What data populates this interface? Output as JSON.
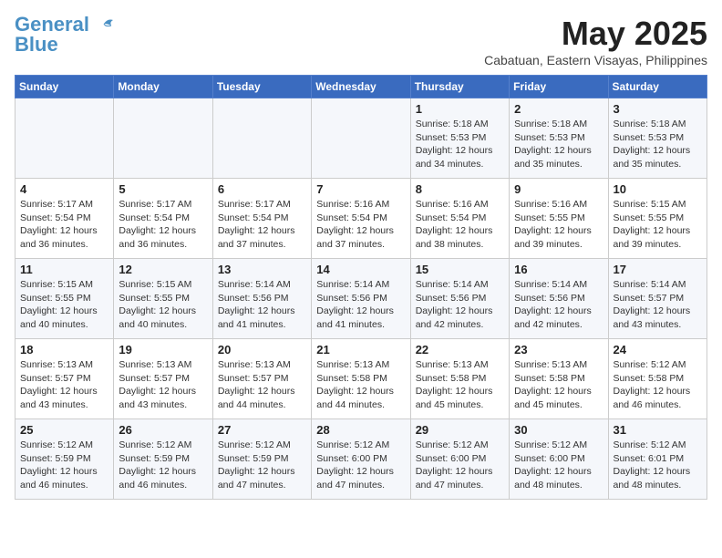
{
  "header": {
    "logo_line1": "General",
    "logo_line2": "Blue",
    "month_title": "May 2025",
    "location": "Cabatuan, Eastern Visayas, Philippines"
  },
  "weekdays": [
    "Sunday",
    "Monday",
    "Tuesday",
    "Wednesday",
    "Thursday",
    "Friday",
    "Saturday"
  ],
  "weeks": [
    [
      {
        "day": "",
        "info": ""
      },
      {
        "day": "",
        "info": ""
      },
      {
        "day": "",
        "info": ""
      },
      {
        "day": "",
        "info": ""
      },
      {
        "day": "1",
        "info": "Sunrise: 5:18 AM\nSunset: 5:53 PM\nDaylight: 12 hours\nand 34 minutes."
      },
      {
        "day": "2",
        "info": "Sunrise: 5:18 AM\nSunset: 5:53 PM\nDaylight: 12 hours\nand 35 minutes."
      },
      {
        "day": "3",
        "info": "Sunrise: 5:18 AM\nSunset: 5:53 PM\nDaylight: 12 hours\nand 35 minutes."
      }
    ],
    [
      {
        "day": "4",
        "info": "Sunrise: 5:17 AM\nSunset: 5:54 PM\nDaylight: 12 hours\nand 36 minutes."
      },
      {
        "day": "5",
        "info": "Sunrise: 5:17 AM\nSunset: 5:54 PM\nDaylight: 12 hours\nand 36 minutes."
      },
      {
        "day": "6",
        "info": "Sunrise: 5:17 AM\nSunset: 5:54 PM\nDaylight: 12 hours\nand 37 minutes."
      },
      {
        "day": "7",
        "info": "Sunrise: 5:16 AM\nSunset: 5:54 PM\nDaylight: 12 hours\nand 37 minutes."
      },
      {
        "day": "8",
        "info": "Sunrise: 5:16 AM\nSunset: 5:54 PM\nDaylight: 12 hours\nand 38 minutes."
      },
      {
        "day": "9",
        "info": "Sunrise: 5:16 AM\nSunset: 5:55 PM\nDaylight: 12 hours\nand 39 minutes."
      },
      {
        "day": "10",
        "info": "Sunrise: 5:15 AM\nSunset: 5:55 PM\nDaylight: 12 hours\nand 39 minutes."
      }
    ],
    [
      {
        "day": "11",
        "info": "Sunrise: 5:15 AM\nSunset: 5:55 PM\nDaylight: 12 hours\nand 40 minutes."
      },
      {
        "day": "12",
        "info": "Sunrise: 5:15 AM\nSunset: 5:55 PM\nDaylight: 12 hours\nand 40 minutes."
      },
      {
        "day": "13",
        "info": "Sunrise: 5:14 AM\nSunset: 5:56 PM\nDaylight: 12 hours\nand 41 minutes."
      },
      {
        "day": "14",
        "info": "Sunrise: 5:14 AM\nSunset: 5:56 PM\nDaylight: 12 hours\nand 41 minutes."
      },
      {
        "day": "15",
        "info": "Sunrise: 5:14 AM\nSunset: 5:56 PM\nDaylight: 12 hours\nand 42 minutes."
      },
      {
        "day": "16",
        "info": "Sunrise: 5:14 AM\nSunset: 5:56 PM\nDaylight: 12 hours\nand 42 minutes."
      },
      {
        "day": "17",
        "info": "Sunrise: 5:14 AM\nSunset: 5:57 PM\nDaylight: 12 hours\nand 43 minutes."
      }
    ],
    [
      {
        "day": "18",
        "info": "Sunrise: 5:13 AM\nSunset: 5:57 PM\nDaylight: 12 hours\nand 43 minutes."
      },
      {
        "day": "19",
        "info": "Sunrise: 5:13 AM\nSunset: 5:57 PM\nDaylight: 12 hours\nand 43 minutes."
      },
      {
        "day": "20",
        "info": "Sunrise: 5:13 AM\nSunset: 5:57 PM\nDaylight: 12 hours\nand 44 minutes."
      },
      {
        "day": "21",
        "info": "Sunrise: 5:13 AM\nSunset: 5:58 PM\nDaylight: 12 hours\nand 44 minutes."
      },
      {
        "day": "22",
        "info": "Sunrise: 5:13 AM\nSunset: 5:58 PM\nDaylight: 12 hours\nand 45 minutes."
      },
      {
        "day": "23",
        "info": "Sunrise: 5:13 AM\nSunset: 5:58 PM\nDaylight: 12 hours\nand 45 minutes."
      },
      {
        "day": "24",
        "info": "Sunrise: 5:12 AM\nSunset: 5:58 PM\nDaylight: 12 hours\nand 46 minutes."
      }
    ],
    [
      {
        "day": "25",
        "info": "Sunrise: 5:12 AM\nSunset: 5:59 PM\nDaylight: 12 hours\nand 46 minutes."
      },
      {
        "day": "26",
        "info": "Sunrise: 5:12 AM\nSunset: 5:59 PM\nDaylight: 12 hours\nand 46 minutes."
      },
      {
        "day": "27",
        "info": "Sunrise: 5:12 AM\nSunset: 5:59 PM\nDaylight: 12 hours\nand 47 minutes."
      },
      {
        "day": "28",
        "info": "Sunrise: 5:12 AM\nSunset: 6:00 PM\nDaylight: 12 hours\nand 47 minutes."
      },
      {
        "day": "29",
        "info": "Sunrise: 5:12 AM\nSunset: 6:00 PM\nDaylight: 12 hours\nand 47 minutes."
      },
      {
        "day": "30",
        "info": "Sunrise: 5:12 AM\nSunset: 6:00 PM\nDaylight: 12 hours\nand 48 minutes."
      },
      {
        "day": "31",
        "info": "Sunrise: 5:12 AM\nSunset: 6:01 PM\nDaylight: 12 hours\nand 48 minutes."
      }
    ]
  ]
}
